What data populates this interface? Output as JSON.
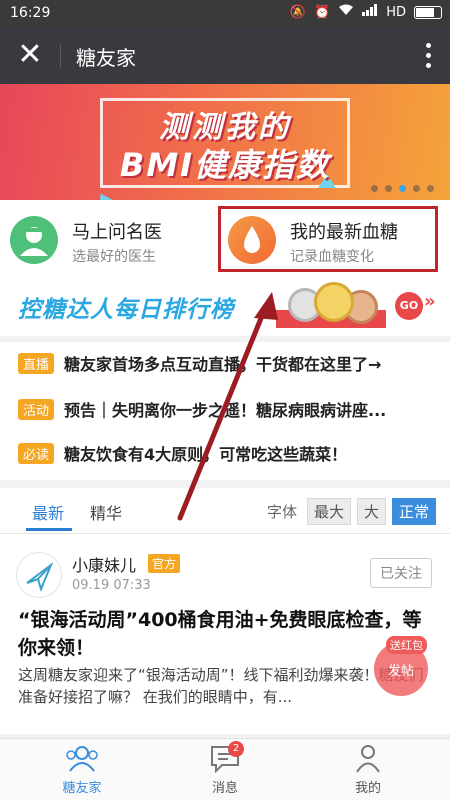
{
  "status_bar": {
    "time": "16:29",
    "network": "HD"
  },
  "titlebar": {
    "close_label": "✕",
    "title": "糖友家"
  },
  "banner": {
    "line1": "测测我的",
    "line2": "BMI健康指数"
  },
  "entries": [
    {
      "title": "马上问名医",
      "subtitle": "选最好的医生"
    },
    {
      "title": "我的最新血糖",
      "subtitle": "记录血糖变化"
    }
  ],
  "rank": {
    "text": "控糖达人每日排行榜",
    "go": "GO"
  },
  "news": [
    {
      "tag": "直播",
      "text": "糖友家首场多点互动直播，干货都在这里了→"
    },
    {
      "tag": "活动",
      "text": "预告｜失明离你一步之遥！糖尿病眼病讲座..."
    },
    {
      "tag": "必读",
      "text": "糖友饮食有4大原则，可常吃这些蔬菜！"
    }
  ],
  "tabs": {
    "latest": "最新",
    "featured": "精华",
    "font_label": "字体",
    "font_options": [
      "最大",
      "大",
      "正常"
    ]
  },
  "post": {
    "author": "小康妹儿",
    "badge": "官方",
    "time": "09.19 07:33",
    "follow": "已关注",
    "title": "“银海活动周”400桶食用油+免费眼底检查，等你来领！",
    "excerpt": "这周糖友家迎来了“银海活动周”！线下福利劲爆来袭！糖友们准备好接招了嘛？ 在我们的眼睛中，有..."
  },
  "red_button": {
    "pill": "送红包",
    "label": "发帖"
  },
  "bottom_nav": [
    {
      "label": "糖友家"
    },
    {
      "label": "消息",
      "badge": "2"
    },
    {
      "label": "我的"
    }
  ],
  "colors": {
    "accent": "#3b8ede",
    "tag": "#f5a623",
    "highlight": "#c0252b"
  }
}
